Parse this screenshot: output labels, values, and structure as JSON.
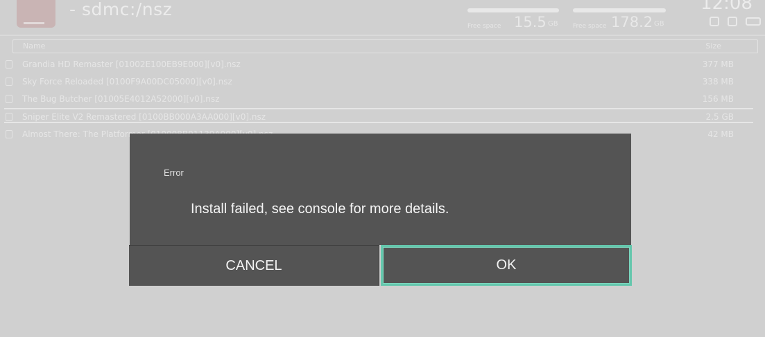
{
  "app": {
    "path": "- sdmc:/nsz",
    "storage": [
      {
        "free_label": "Free space",
        "value": "15.5",
        "unit": "GB",
        "fill_fraction": 0.85
      },
      {
        "free_label": "Free space",
        "value": "178.2",
        "unit": "GB",
        "fill_fraction": 0.9
      }
    ],
    "clock": "12:08",
    "list_header": {
      "name": "Name",
      "size": "Size"
    },
    "files": [
      {
        "name": "Grandia HD Remaster [01002E100EB9E000][v0].nsz",
        "size": "377 MB"
      },
      {
        "name": "Sky Force Reloaded [0100F9A00DC05000][v0].nsz",
        "size": "338 MB"
      },
      {
        "name": "The Bug Butcher [01005E4012A52000][v0].nsz",
        "size": "156 MB"
      },
      {
        "name": "Sniper Elite V2 Remastered [0100BB000A3AA000][v0].nsz",
        "size": "2.5 GB",
        "selected": true
      },
      {
        "name": "Almost There: The Platformer [010008B01139A000][v0].nsz",
        "size": "42 MB"
      }
    ]
  },
  "dialog": {
    "title": "Error",
    "message": "Install failed, see console for more details.",
    "cancel_label": "CANCEL",
    "ok_label": "OK",
    "accent_color": "#65c7ad"
  }
}
